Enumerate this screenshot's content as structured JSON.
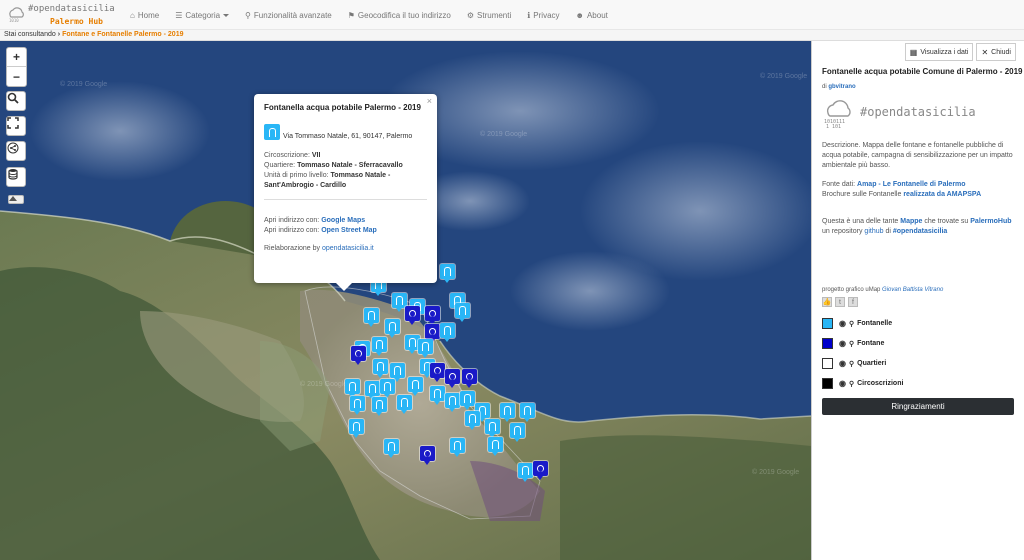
{
  "brand": {
    "title": "#opendatasicilia",
    "subtitle": "Palermo Hub"
  },
  "nav": [
    {
      "icon": "home-icon",
      "glyph": "⌂",
      "label": "Home"
    },
    {
      "icon": "list-icon",
      "glyph": "☰",
      "label": "Categoria"
    },
    {
      "icon": "search-icon",
      "glyph": "⚲",
      "label": "Funzionalità avanzate"
    },
    {
      "icon": "pin-icon",
      "glyph": "⚑",
      "label": "Geocodifica il tuo indirizzo"
    },
    {
      "icon": "gear-icon",
      "glyph": "⚙",
      "label": "Strumenti"
    },
    {
      "icon": "info-icon",
      "glyph": "ℹ",
      "label": "Privacy"
    },
    {
      "icon": "users-icon",
      "glyph": "☻",
      "label": "About"
    }
  ],
  "breadcrumb": {
    "prefix": "Stai consultando",
    "current": "Fontane e Fontanelle Palermo - 2019"
  },
  "map": {
    "watermark": "© 2019 Google",
    "controls": {
      "zoom_in": "+",
      "zoom_out": "−"
    }
  },
  "popup": {
    "close": "×",
    "title": "Fontanella acqua potabile Palermo - 2019",
    "address": "Via Tommaso Natale, 61, 90147, Palermo",
    "circ_label": "Circoscrizione: ",
    "circ_value": "VII",
    "quart_label": "Quartiere: ",
    "quart_value": "Tommaso Natale - Sferracavallo",
    "unit_label": "Unità di primo livello: ",
    "unit_value": "Tommaso Natale - Sant'Ambrogio - Cardillo",
    "open_with": "Apri indirizzo con: ",
    "google_maps": "Google Maps",
    "osm": "Open Street Map",
    "credit_label": "Rielaborazione by ",
    "credit_link": "opendatasicilia.it"
  },
  "panel": {
    "btn_data": "Visualizza i dati",
    "btn_close": "Chiudi",
    "title": "Fontanelle acqua potabile Comune di Palermo - 2019",
    "author_prefix": "di ",
    "author": "gbvitrano",
    "logo_text": "#opendatasicilia",
    "description": "Descrizione. Mappa delle fontane e fontanelle pubbliche di acqua potabile, campagna di sensibilizzazione per un impatto ambientale più basso.",
    "fonte_label": "Fonte dati: ",
    "fonte_link": "Amap - Le Fontanelle di Palermo",
    "brochure_text": "Brochure sulle Fontanelle ",
    "brochure_link": "realizzata da AMAPSPA",
    "mappe_1": "Questa è una delle tante ",
    "mappe_link": "Mappe",
    "mappe_2": " che trovate su ",
    "hub_link": "PalermoHub",
    "mappe_3": " un repository ",
    "github_link": "github",
    "mappe_4": " di ",
    "ods_link": "#opendatasicilia",
    "project_prefix": "progetto grafico uMap ",
    "project_author": "Giovan Battista Vitrano",
    "layers": [
      {
        "label": "Fontanelle",
        "color": "#29b6f6"
      },
      {
        "label": "Fontane",
        "color": "#0000cc"
      },
      {
        "label": "Quartieri",
        "color": "#ffffff"
      },
      {
        "label": "Circoscrizioni",
        "color": "#000000"
      }
    ],
    "thanks": "Ringraziamenti"
  }
}
